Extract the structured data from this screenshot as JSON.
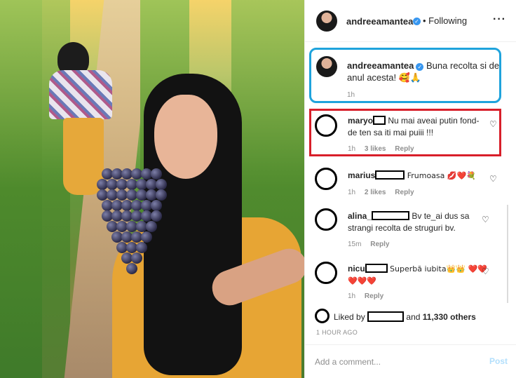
{
  "post": {
    "username": "andreeamantea",
    "follow_status": "Following",
    "more_icon": "more-horizontal-icon"
  },
  "caption": {
    "username": "andreeamantea",
    "text": "Buna recolta si de anul acesta! 🥰🙏",
    "time": "1h"
  },
  "comments": [
    {
      "user": "maryo",
      "text": "Nu mai aveai putin fond-de ten sa iti mai puiii !!!",
      "time": "1h",
      "likes": "3 likes",
      "reply": "Reply"
    },
    {
      "user": "marius",
      "text": "Frumoasa 💋❤️💐",
      "time": "1h",
      "likes": "2 likes",
      "reply": "Reply"
    },
    {
      "user": "alina_",
      "text": "Bv te_ai dus sa strangi recolta de struguri bv.",
      "time": "15m",
      "reply": "Reply"
    },
    {
      "user": "nicu",
      "text": "Superbă iubita👑👑 ❤️❤️❤️❤️❤️",
      "time": "1h",
      "reply": "Reply"
    }
  ],
  "likes": {
    "prefix": "Liked by",
    "middle": "and",
    "count": "11,330 others"
  },
  "time_ago": "1 HOUR AGO",
  "add_comment": {
    "placeholder": "Add a comment...",
    "post_label": "Post"
  },
  "colors": {
    "highlight_blue": "#1fa3dc",
    "highlight_red": "#d81f2a",
    "verified": "#3897f0"
  }
}
